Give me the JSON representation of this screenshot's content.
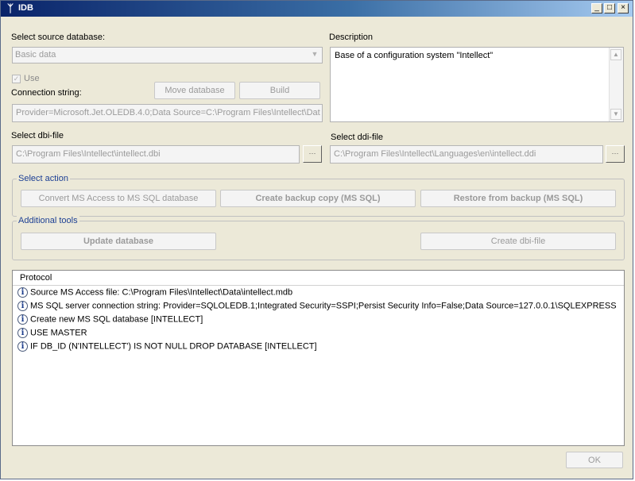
{
  "window": {
    "title": "IDB",
    "minimize": "_",
    "maximize": "□",
    "close": "×"
  },
  "source": {
    "label": "Select source database:",
    "value": "Basic data"
  },
  "description": {
    "label": "Description",
    "text": "Base of a configuration system \"Intellect\""
  },
  "use": {
    "label": "Use",
    "checked": true
  },
  "connection": {
    "label": "Connection string:",
    "value": "Provider=Microsoft.Jet.OLEDB.4.0;Data Source=C:\\Program Files\\Intellect\\Dat"
  },
  "buttons": {
    "move_database": "Move database",
    "build": "Build",
    "ok": "OK"
  },
  "dbi": {
    "label": "Select dbi-file",
    "value": "C:\\Program Files\\Intellect\\intellect.dbi"
  },
  "ddi": {
    "label": "Select ddi-file",
    "value": "C:\\Program Files\\Intellect\\Languages\\en\\intellect.ddi"
  },
  "select_action": {
    "title": "Select action",
    "convert": "Convert MS Access to MS SQL database",
    "backup": "Create backup copy (MS SQL)",
    "restore": "Restore from backup (MS SQL)"
  },
  "additional_tools": {
    "title": "Additional tools",
    "update": "Update database",
    "create_dbi": "Create dbi-file"
  },
  "protocol": {
    "header": "Protocol",
    "rows": [
      "Source MS Access file: C:\\Program Files\\Intellect\\Data\\intellect.mdb",
      "MS SQL server connection string: Provider=SQLOLEDB.1;Integrated Security=SSPI;Persist Security Info=False;Data Source=127.0.0.1\\SQLEXPRESS",
      "Create new MS SQL database [INTELLECT]",
      "USE MASTER",
      "IF DB_ID (N'INTELLECT') IS NOT NULL DROP DATABASE [INTELLECT]"
    ]
  }
}
